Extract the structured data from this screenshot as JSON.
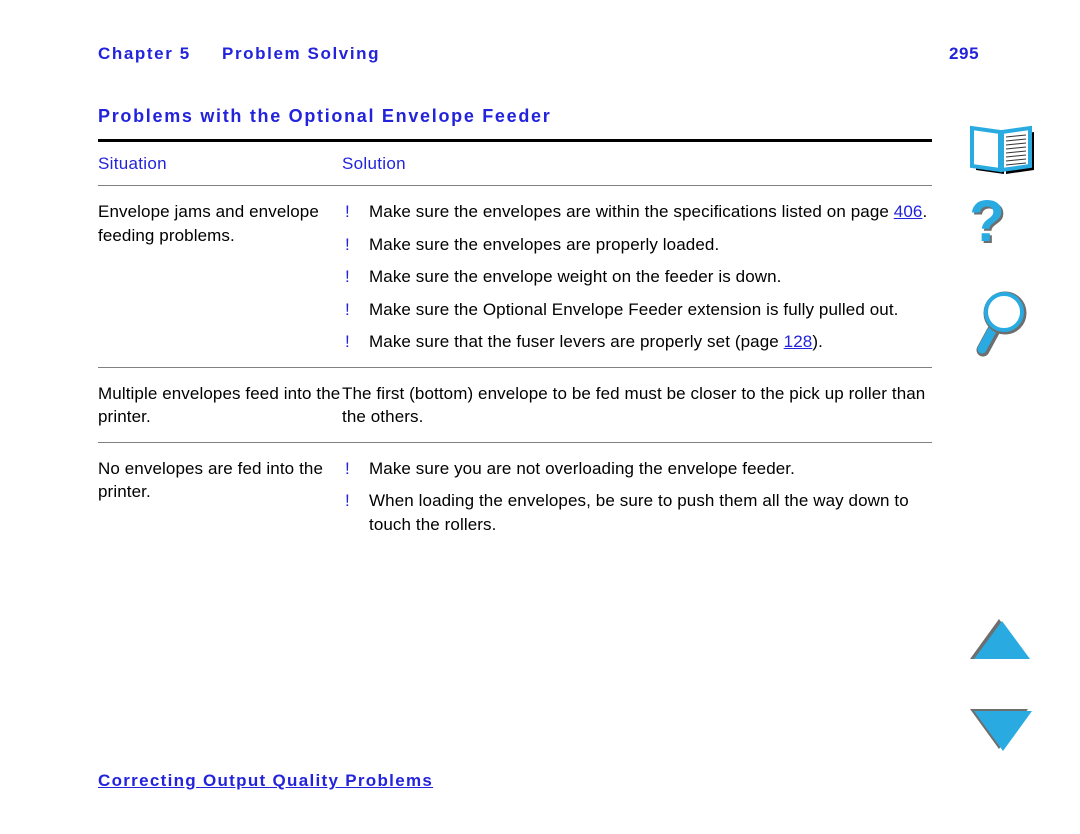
{
  "header": {
    "chapter_label": "Chapter 5",
    "chapter_title": "Problem Solving",
    "page_number": "295"
  },
  "section": {
    "title": "Problems with the Optional Envelope Feeder"
  },
  "table": {
    "columns": [
      "Situation",
      "Solution"
    ],
    "rows": [
      {
        "situation": "Envelope jams and envelope feeding problems.",
        "bullet_marker": "!",
        "solutions": [
          {
            "text_before": "Make sure the envelopes are within the specifications listed on page ",
            "link": "406",
            "text_after": "."
          },
          {
            "text_before": "Make sure the envelopes are properly loaded.",
            "link": "",
            "text_after": ""
          },
          {
            "text_before": "Make sure the envelope weight on the feeder is down.",
            "link": "",
            "text_after": ""
          },
          {
            "text_before": "Make sure the Optional Envelope Feeder extension is fully pulled out.",
            "link": "",
            "text_after": ""
          },
          {
            "text_before": "Make sure that the fuser levers are properly set (page ",
            "link": "128",
            "text_after": ")."
          }
        ],
        "plain_solution": ""
      },
      {
        "situation": "Multiple envelopes feed into the printer.",
        "bullet_marker": "",
        "solutions": [],
        "plain_solution": "The first (bottom) envelope to be fed must be closer to the pick up roller than the others."
      },
      {
        "situation": "No envelopes are fed into the printer.",
        "bullet_marker": "!",
        "solutions": [
          {
            "text_before": "Make sure you are not overloading the envelope feeder.",
            "link": "",
            "text_after": ""
          },
          {
            "text_before": "When loading the envelopes, be sure to push them all the way down to touch the rollers.",
            "link": "",
            "text_after": ""
          }
        ],
        "plain_solution": ""
      }
    ]
  },
  "footer": {
    "link_text": "Correcting Output Quality Problems"
  },
  "icons": [
    {
      "name": "open-book-icon",
      "label": "book"
    },
    {
      "name": "question-mark-icon",
      "label": "help"
    },
    {
      "name": "magnifying-glass-icon",
      "label": "search"
    },
    {
      "name": "triangle-up-icon",
      "label": "previous page"
    },
    {
      "name": "triangle-down-icon",
      "label": "next page"
    }
  ],
  "colors": {
    "link_blue": "#2323dc",
    "icon_cyan": "#29ABE2",
    "icon_shadow": "#6e6e6e",
    "rule_dark": "#000000",
    "rule_light": "#808080"
  }
}
